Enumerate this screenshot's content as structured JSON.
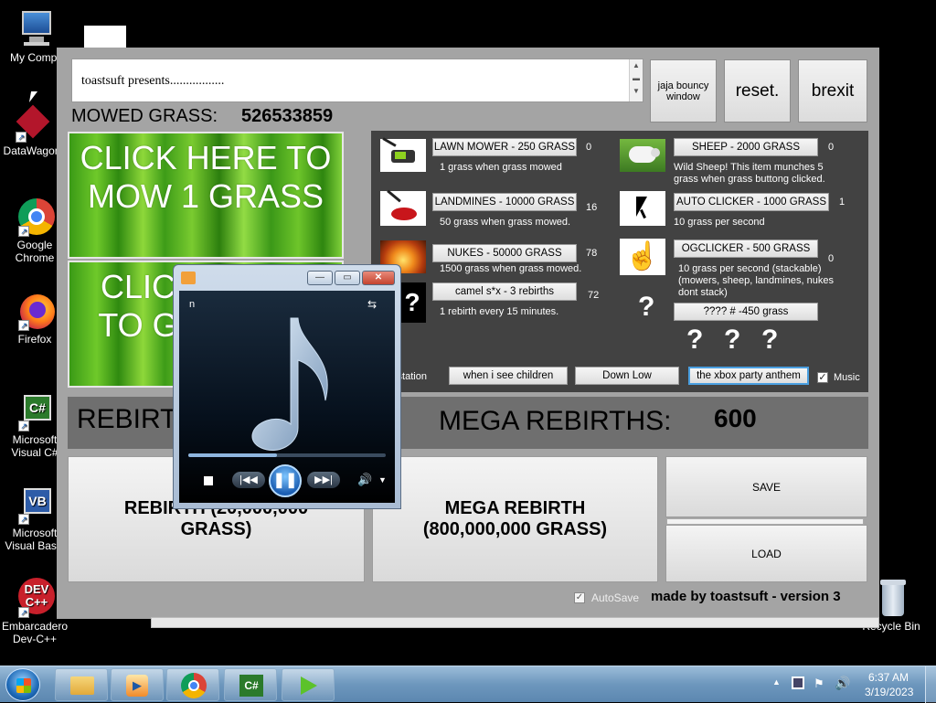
{
  "desktop": {
    "icons": [
      {
        "label": "My Compu",
        "icon": "computer-icon"
      },
      {
        "label": "DataWagon",
        "icon": "datawagon-icon"
      },
      {
        "label": "Google Chrome",
        "icon": "chrome-icon"
      },
      {
        "label": "Firefox",
        "icon": "firefox-icon"
      },
      {
        "label": "Microsoft Visual C#",
        "icon": "visual-csharp-icon"
      },
      {
        "label": "Microsoft Visual Basic",
        "icon": "visual-basic-icon"
      },
      {
        "label": "Embarcadero Dev-C++",
        "icon": "devcpp-icon"
      },
      {
        "label": "Recycle Bin",
        "icon": "recycle-bin-icon"
      }
    ]
  },
  "app": {
    "top_text": "toastsuft presents.................",
    "buttons": {
      "bouncy": "jaja bouncy window",
      "reset": "reset.",
      "brexit": "brexit"
    },
    "mowed_label": "MOWED GRASS:",
    "mowed_value": "526533859",
    "click_text": "CLICK HERE TO MOW 1 GRASS",
    "click_text_partial": "CLIC TO G",
    "shop": {
      "items": [
        {
          "button": "LAWN MOWER - 250 GRASS",
          "count": "0",
          "desc": "1 grass when grass mowed",
          "icon": "lawn-mower-icon"
        },
        {
          "button": "LANDMINES - 10000 GRASS",
          "count": "16",
          "desc": "50 grass when grass mowed.",
          "icon": "landmine-icon"
        },
        {
          "button": "NUKES - 50000 GRASS",
          "count": "78",
          "desc": "1500 grass when grass mowed.",
          "icon": "nuke-explosion-icon"
        },
        {
          "button": "camel s*x - 3 rebirths",
          "count": "72",
          "desc": "1 rebirth every 15 minutes.",
          "icon": "question-mark-icon"
        },
        {
          "button": "SHEEP - 2000 GRASS",
          "count": "0",
          "desc": "Wild Sheep! This item munches 5 grass when grass buttong clicked.",
          "icon": "sheep-icon"
        },
        {
          "button": "AUTO CLICKER - 1000 GRASS",
          "count": "1",
          "desc": "10 grass per second",
          "icon": "cursor-arrow-icon"
        },
        {
          "button": "OGCLICKER - 500 GRASS",
          "count": "0",
          "desc": "10 grass per second (stackable) (mowers, sheep, landmines, nukes dont stack)",
          "icon": "hand-pointer-icon"
        },
        {
          "button": "???? # -450 grass",
          "count": "",
          "desc": "",
          "icon": "question-mark-icon"
        }
      ],
      "qmarks": [
        "?",
        "?",
        "?",
        "?"
      ],
      "music_station_label": "c station",
      "music_buttons": [
        "when i see children",
        "Down Low",
        "the xbox party anthem"
      ],
      "music_checkbox_label": "Music",
      "music_checked": true
    },
    "rebirths_label": "REBIRT",
    "mega_rebirths_label": "MEGA REBIRTHS:",
    "mega_rebirths_value": "600",
    "rebirth_button": "REBIRTH (20,000,000 GRASS)",
    "mega_rebirth_button": "MEGA REBIRTH (800,000,000 GRASS)",
    "save_button": "SAVE",
    "load_button": "LOAD",
    "autosave_label": "AutoSave",
    "autosave_checked": true,
    "footer": "made by toastsuft - version 3"
  },
  "media_player": {
    "title_letter": "n",
    "controls": [
      "stop-icon",
      "previous-icon",
      "pause-icon",
      "next-icon",
      "volume-icon"
    ],
    "progress": 0.45
  },
  "taskbar": {
    "time": "6:37 AM",
    "date": "3/19/2023",
    "apps": [
      "windows-explorer-icon",
      "media-player-icon",
      "chrome-icon",
      "visual-csharp-icon",
      "run-app-icon"
    ]
  }
}
